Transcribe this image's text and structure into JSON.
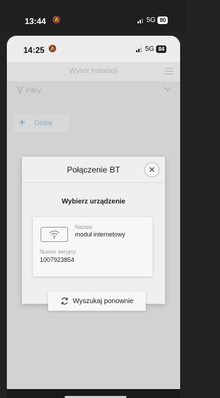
{
  "outer_status": {
    "time": "13:44",
    "network": "5G",
    "battery": "80"
  },
  "inner_status": {
    "time": "14:25",
    "network": "5G",
    "battery": "84"
  },
  "header": {
    "title": "Wybór instalacji"
  },
  "filter": {
    "label": "Filtry"
  },
  "add": {
    "label": "Dodaj"
  },
  "modal": {
    "title": "Połączenie BT",
    "subtitle": "Wybierz urządzenie",
    "device": {
      "name_label": "Nazwa:",
      "name_value": "moduł internetowy",
      "serial_label": "Numer seryjny:",
      "serial_value": "1007923854"
    },
    "rescan_label": "Wyszukaj ponownie"
  },
  "icons": [
    "bell-off-icon",
    "signal-icon",
    "menu-icon",
    "filter-icon",
    "chevron-down-icon",
    "plus-icon",
    "close-icon",
    "wifi-icon",
    "refresh-icon"
  ],
  "colors": {
    "accent": "#8fa9c6"
  }
}
